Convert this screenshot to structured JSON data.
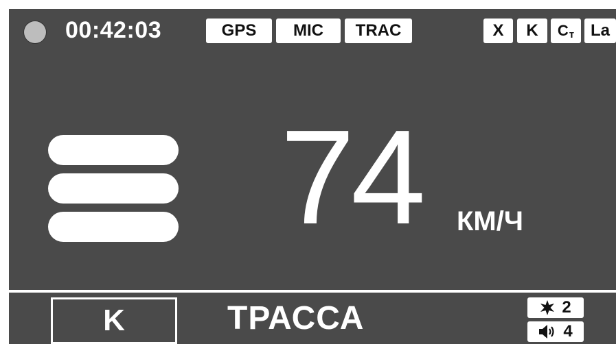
{
  "status_bar": {
    "time": "00:42:03",
    "left_badges": [
      "GPS",
      "MIC",
      "TRAC"
    ],
    "right_badges": [
      "X",
      "K",
      "Ст",
      "La"
    ]
  },
  "signal": {
    "level": 3,
    "max_level": 3
  },
  "speed": {
    "value": "74",
    "unit": "КМ/Ч"
  },
  "bottom": {
    "band": "K",
    "mode": "ТРАССА",
    "brightness_level": "2",
    "volume_level": "4"
  },
  "colors": {
    "screen_background": "#4a4a4a",
    "foreground": "#ffffff",
    "badge_text": "#111111"
  }
}
